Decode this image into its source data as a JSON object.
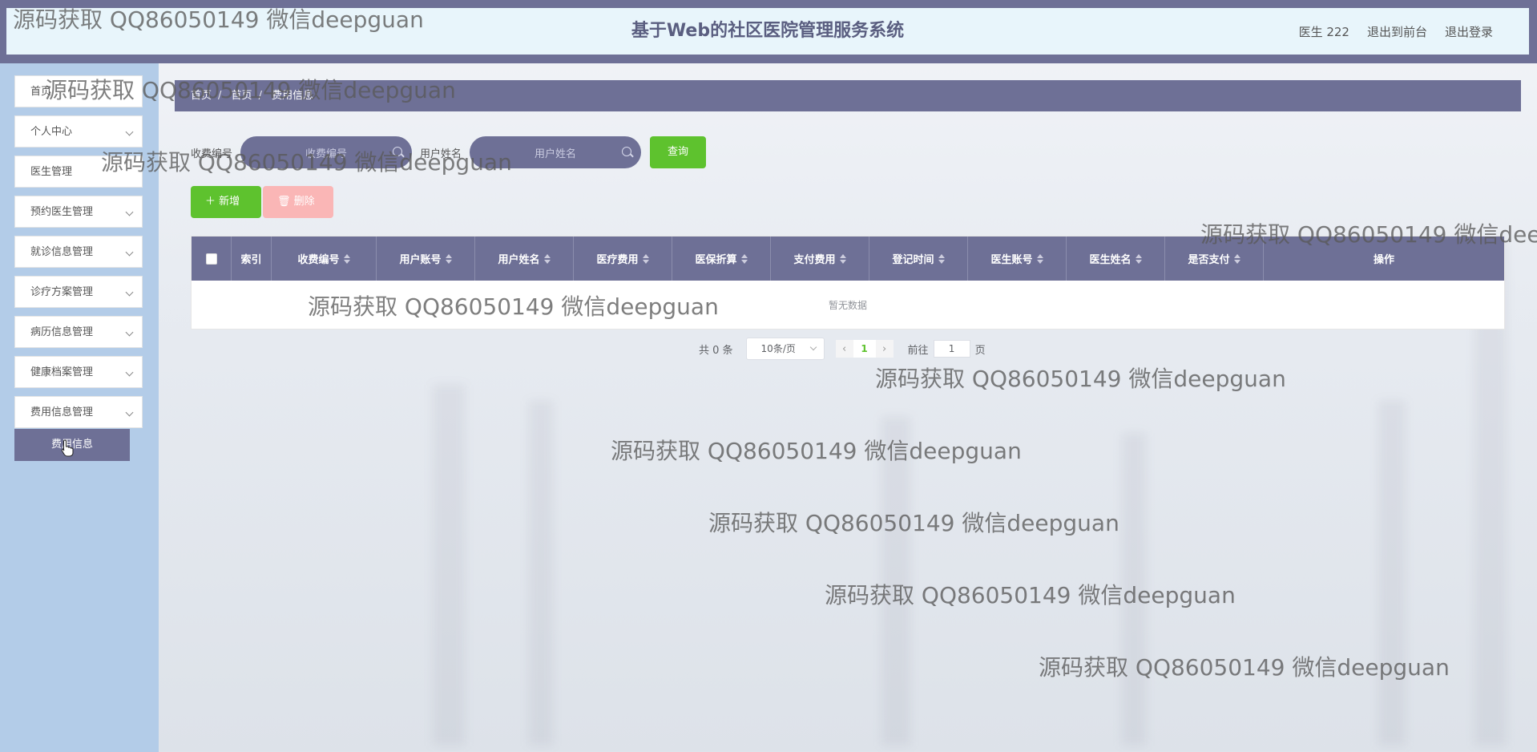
{
  "header": {
    "title": "基于Web的社区医院管理服务系统",
    "user_label": "医生 222",
    "back_to_front": "退出到前台",
    "logout": "退出登录"
  },
  "sidebar": {
    "items": [
      {
        "label": "首页"
      },
      {
        "label": "个人中心"
      },
      {
        "label": "医生管理"
      },
      {
        "label": "预约医生管理"
      },
      {
        "label": "就诊信息管理"
      },
      {
        "label": "诊疗方案管理"
      },
      {
        "label": "病历信息管理"
      },
      {
        "label": "健康档案管理"
      },
      {
        "label": "费用信息管理"
      }
    ],
    "active_sub": "费用信息"
  },
  "breadcrumb": [
    "首页",
    "首页",
    "费用信息"
  ],
  "search": {
    "fee_label": "收费编号",
    "fee_placeholder": "收费编号",
    "user_label": "用户姓名",
    "user_placeholder": "用户姓名",
    "query_button": "查询"
  },
  "actions": {
    "add": "新增",
    "delete": "删除"
  },
  "table": {
    "columns": [
      "索引",
      "收费编号",
      "用户账号",
      "用户姓名",
      "医疗费用",
      "医保折算",
      "支付费用",
      "登记时间",
      "医生账号",
      "医生姓名",
      "是否支付",
      "操作"
    ],
    "empty_text": "暂无数据"
  },
  "pagination": {
    "total": "共 0 条",
    "page_size": "10条/页",
    "current_page": "1",
    "goto_prefix": "前往",
    "goto_value": "1",
    "goto_suffix": "页"
  },
  "watermark": "源码获取 QQ86050149 微信deepguan"
}
